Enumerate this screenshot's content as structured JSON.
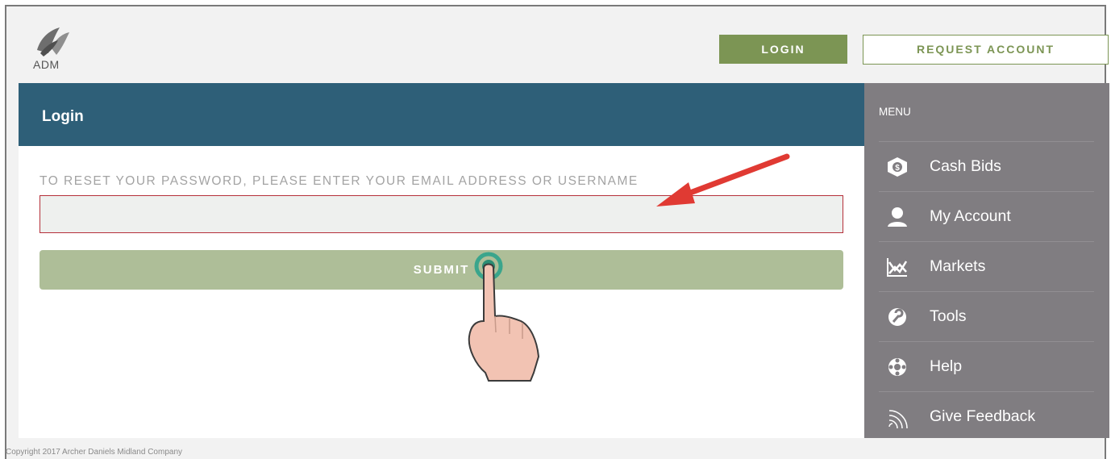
{
  "brand": {
    "logo_text": "ADM"
  },
  "header": {
    "login_label": "LOGIN",
    "request_label": "REQUEST ACCOUNT"
  },
  "panel": {
    "title": "Login",
    "reset_label": "TO RESET YOUR PASSWORD, PLEASE ENTER YOUR EMAIL ADDRESS OR USERNAME",
    "input_value": "",
    "input_placeholder": "",
    "submit_label": "SUBMIT"
  },
  "sidebar": {
    "title": "MENU",
    "items": [
      {
        "label": "Cash Bids",
        "icon": "cash-bids-icon"
      },
      {
        "label": "My Account",
        "icon": "user-icon"
      },
      {
        "label": "Markets",
        "icon": "chart-icon"
      },
      {
        "label": "Tools",
        "icon": "tools-icon"
      },
      {
        "label": "Help",
        "icon": "help-icon"
      },
      {
        "label": "Give Feedback",
        "icon": "feedback-icon"
      }
    ]
  },
  "footer": {
    "copyright": "Copyright 2017 Archer Daniels Midland Company"
  },
  "colors": {
    "primary_green": "#7c9554",
    "submit_green": "#aebe98",
    "header_blue": "#2e5f78",
    "sidebar_gray": "#807d81",
    "annotation_red": "#e03a33"
  }
}
